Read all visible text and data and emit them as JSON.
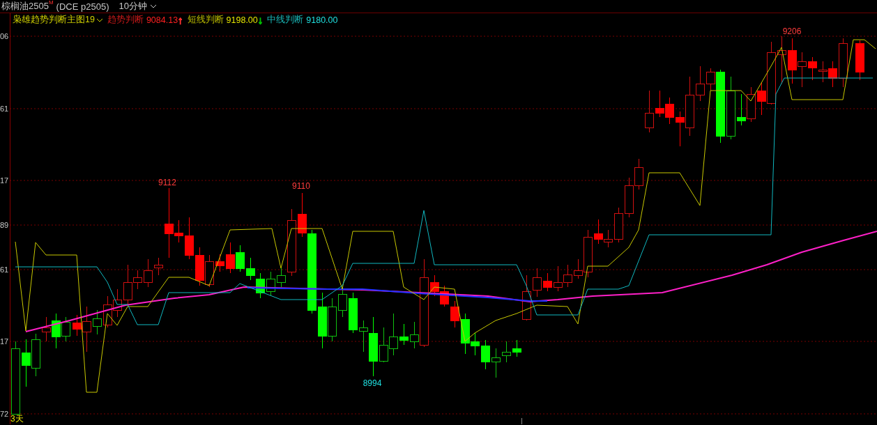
{
  "header": {
    "instrument": "棕榈油2505",
    "flag": "M",
    "code": "(DCE  p2505)",
    "period": "10分钟"
  },
  "indicator": {
    "name": "枭雄趋势判断主图19",
    "items": [
      {
        "label": "趋势判断",
        "value": "9084.13",
        "arrow": {
          "text": "↑",
          "color": "#ff3030"
        },
        "color": "#ff2020"
      },
      {
        "label": "短线判断",
        "value": "9198.00",
        "arrow": {
          "text": "↓",
          "color": "#00c000"
        },
        "color": "#e6e600"
      },
      {
        "label": "中线判断",
        "value": "9180.00",
        "color": "#20e0e0"
      }
    ]
  },
  "axis_labels": [
    "06",
    "61",
    "17",
    "89",
    "61",
    "17",
    "72"
  ],
  "annotations": [
    {
      "text": "9112",
      "color": "#ff3c3c"
    },
    {
      "text": "9110",
      "color": "#ff3c3c"
    },
    {
      "text": "8994",
      "color": "#20e0e0"
    },
    {
      "text": "9206",
      "color": "#ff3c3c"
    }
  ],
  "range_label": "3天"
}
